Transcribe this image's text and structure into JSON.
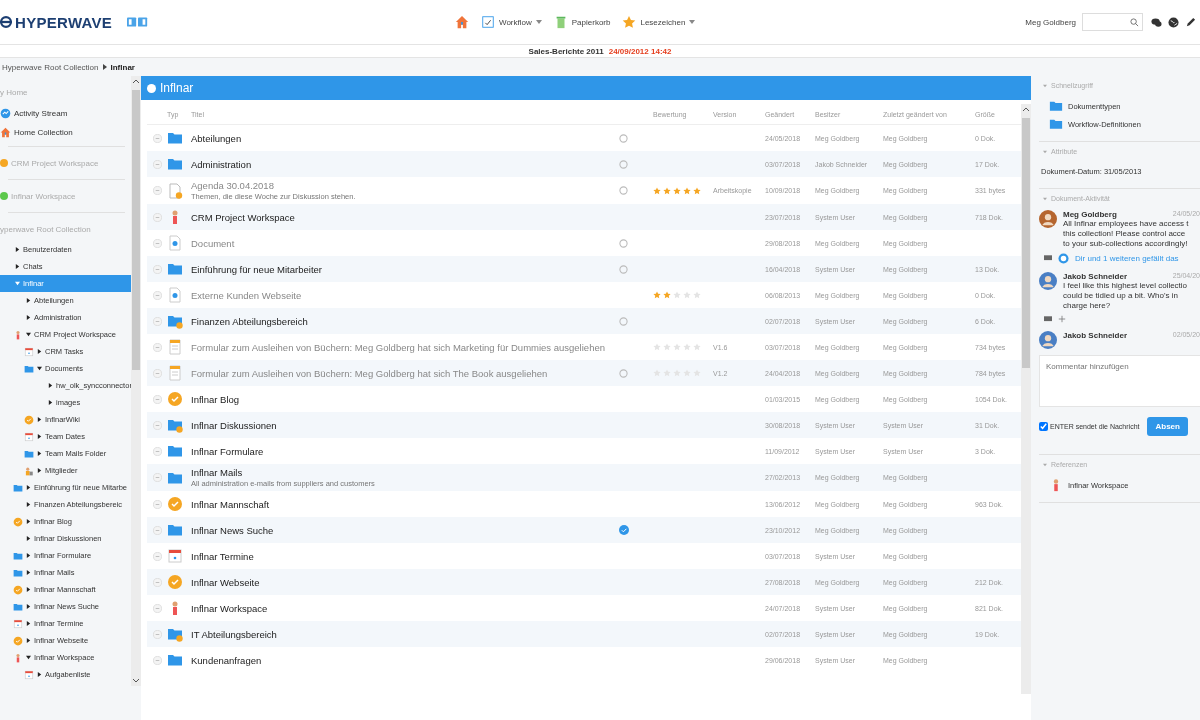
{
  "header": {
    "logo": "HYPERWAVE",
    "nav": [
      {
        "kind": "home"
      },
      {
        "kind": "workflow",
        "label": "Workflow",
        "dropdown": true
      },
      {
        "kind": "trash",
        "label": "Papierkorb",
        "dropdown": false
      },
      {
        "kind": "star",
        "label": "Lesezeichen",
        "dropdown": true
      }
    ],
    "user": "Meg Goldberg"
  },
  "context": {
    "title": "Sales-Berichte 2011",
    "timestamp": "24/09/2012 14:42"
  },
  "breadcrumb": [
    "Hyperwave Root Collection",
    "Inflnar"
  ],
  "sidebar": {
    "home_heading": "y Home",
    "home_items": [
      {
        "kind": "activity",
        "label": "Activity Stream"
      },
      {
        "kind": "home",
        "label": "Home Collection"
      }
    ],
    "workspaces": [
      {
        "label": "CRM Project Workspace",
        "color": "#f5a623"
      },
      {
        "label": "Inflnar Workspace",
        "color": "#5cc84c"
      }
    ],
    "root_heading": "yperwave Root Collection",
    "tree": [
      {
        "label": "Benutzerdaten",
        "expanded": false,
        "selected": false
      },
      {
        "label": "Chats",
        "expanded": false,
        "selected": false
      },
      {
        "label": "Inflnar",
        "expanded": true,
        "selected": true,
        "children": [
          {
            "label": "Abteilungen",
            "expanded": false,
            "selected": false
          },
          {
            "label": "Administration",
            "expanded": false,
            "selected": false
          },
          {
            "label": "CRM Project Workspace",
            "kind": "person",
            "expanded": true,
            "selected": false,
            "children": [
              {
                "label": "CRM Tasks",
                "kind": "calendar",
                "expanded": false,
                "selected": false
              },
              {
                "label": "Documents",
                "kind": "folder",
                "expanded": true,
                "selected": false,
                "children": [
                  {
                    "label": "hw_olk_syncconnector",
                    "expanded": false,
                    "selected": false
                  },
                  {
                    "label": "images",
                    "expanded": false,
                    "selected": false
                  }
                ]
              },
              {
                "label": "InflnarWiki",
                "kind": "blog",
                "expanded": false,
                "selected": false
              },
              {
                "label": "Team Dates",
                "kind": "calendar",
                "expanded": false,
                "selected": false
              },
              {
                "label": "Team Mails Folder",
                "kind": "folder",
                "expanded": false,
                "selected": false
              },
              {
                "label": "Mitglieder",
                "kind": "people",
                "expanded": false,
                "selected": false
              }
            ]
          },
          {
            "label": "Einführung für neue Mitarbe",
            "kind": "folder",
            "expanded": false,
            "selected": false
          },
          {
            "label": "Finanzen Abteilungsbereic",
            "expanded": false,
            "selected": false
          },
          {
            "label": "Inflnar Blog",
            "kind": "blog",
            "expanded": false,
            "selected": false
          },
          {
            "label": "Inflnar Diskussionen",
            "expanded": false,
            "selected": false
          },
          {
            "label": "Inflnar Formulare",
            "kind": "folder",
            "expanded": false,
            "selected": false
          },
          {
            "label": "Inflnar Mails",
            "kind": "folder",
            "expanded": false,
            "selected": false
          },
          {
            "label": "Inflnar Mannschaft",
            "kind": "blog",
            "expanded": false,
            "selected": false
          },
          {
            "label": "Inflnar News Suche",
            "kind": "folder",
            "expanded": false,
            "selected": false
          },
          {
            "label": "Inflnar Termine",
            "kind": "calendar",
            "expanded": false,
            "selected": false
          },
          {
            "label": "Inflnar Webseite",
            "kind": "blog",
            "expanded": false,
            "selected": false
          },
          {
            "label": "Inflnar Workspace",
            "kind": "person",
            "expanded": true,
            "selected": false,
            "children": [
              {
                "label": "Aufgabenliste",
                "kind": "calendar",
                "expanded": false,
                "selected": false
              }
            ]
          }
        ]
      }
    ]
  },
  "panel": {
    "title": "Inflnar"
  },
  "table": {
    "columns": [
      "Typ",
      "Titel",
      "",
      "Bewertung",
      "Version",
      "Geändert",
      "Besitzer",
      "Zuletzt geändert von",
      "Größe"
    ],
    "rows": [
      {
        "kind": "folder",
        "title": "Abteilungen",
        "muted": false,
        "marker": {
          "kind": "circle"
        },
        "date": "24/05/2018",
        "owner": "Meg Goldberg",
        "modifier": "Meg Goldberg",
        "size": "0 Dok."
      },
      {
        "kind": "folder",
        "title": "Administration",
        "muted": false,
        "marker": {
          "kind": "circle"
        },
        "date": "03/07/2018",
        "owner": "Jakob Schneider",
        "modifier": "Meg Goldberg",
        "size": "17 Dok."
      },
      {
        "kind": "doc-alert",
        "title": "Agenda 30.04.2018",
        "subtitle": "Themen, die diese Woche zur Diskussion stehen.",
        "muted": true,
        "marker": {
          "kind": "circle"
        },
        "stars": 5,
        "version": "Arbeitskopie",
        "date": "10/09/2018",
        "owner": "Meg Goldberg",
        "modifier": "Meg Goldberg",
        "size": "331 bytes"
      },
      {
        "kind": "person",
        "title": "CRM Project Workspace",
        "muted": false,
        "date": "23/07/2018",
        "owner": "System User",
        "modifier": "Meg Goldberg",
        "size": "718 Dok."
      },
      {
        "kind": "web",
        "title": "Document",
        "muted": true,
        "marker": {
          "kind": "circle"
        },
        "date": "29/08/2018",
        "owner": "Meg Goldberg",
        "modifier": "Meg Goldberg"
      },
      {
        "kind": "folder",
        "title": "Einführung für neue Mitarbeiter",
        "muted": false,
        "marker": {
          "kind": "circle"
        },
        "date": "16/04/2018",
        "owner": "System User",
        "modifier": "Meg Goldberg",
        "size": "13 Dok."
      },
      {
        "kind": "web",
        "title": "Externe Kunden Webseite",
        "muted": true,
        "stars": 2,
        "date": "06/08/2013",
        "owner": "Meg Goldberg",
        "modifier": "Meg Goldberg",
        "size": "0 Dok."
      },
      {
        "kind": "folder-alert",
        "title": "Finanzen Abteilungsbereich",
        "muted": false,
        "marker": {
          "kind": "circle"
        },
        "date": "02/07/2018",
        "owner": "System User",
        "modifier": "Meg Goldberg",
        "size": "6 Dok."
      },
      {
        "kind": "form",
        "title": "Formular zum Ausleihen von Büchern: Meg Goldberg hat sich Marketing für Dummies ausgeliehen",
        "muted": true,
        "stars": 0,
        "version": "V1.6",
        "date": "03/07/2018",
        "owner": "Meg Goldberg",
        "modifier": "Meg Goldberg",
        "size": "734 bytes"
      },
      {
        "kind": "form",
        "title": "Formular zum Ausleihen von Büchern: Meg Goldberg hat sich The Book ausgeliehen",
        "muted": true,
        "marker": {
          "kind": "circle"
        },
        "stars": 0,
        "version": "V1.2",
        "date": "24/04/2018",
        "owner": "Meg Goldberg",
        "modifier": "Meg Goldberg",
        "size": "784 bytes"
      },
      {
        "kind": "blog",
        "title": "Inflnar Blog",
        "muted": false,
        "date": "01/03/2015",
        "owner": "Meg Goldberg",
        "modifier": "Meg Goldberg",
        "size": "1054 Dok."
      },
      {
        "kind": "folder-alert",
        "title": "Inflnar Diskussionen",
        "muted": false,
        "date": "30/08/2018",
        "owner": "System User",
        "modifier": "System User",
        "size": "31 Dok."
      },
      {
        "kind": "folder",
        "title": "Inflnar Formulare",
        "muted": false,
        "date": "11/09/2012",
        "owner": "System User",
        "modifier": "System User",
        "size": "3 Dok."
      },
      {
        "kind": "folder",
        "title": "Inflnar Mails",
        "subtitle": "All administration e-mails from suppliers and customers",
        "muted": false,
        "date": "27/02/2013",
        "owner": "Meg Goldberg",
        "modifier": "Meg Goldberg"
      },
      {
        "kind": "blog",
        "title": "Inflnar Mannschaft",
        "muted": false,
        "date": "13/06/2012",
        "owner": "Meg Goldberg",
        "modifier": "Meg Goldberg",
        "size": "963 Dok."
      },
      {
        "kind": "folder",
        "title": "Inflnar News Suche",
        "muted": false,
        "marker": {
          "kind": "checked"
        },
        "date": "23/10/2012",
        "owner": "Meg Goldberg",
        "modifier": "Meg Goldberg"
      },
      {
        "kind": "calendar",
        "title": "Inflnar Termine",
        "muted": false,
        "date": "03/07/2018",
        "owner": "System User",
        "modifier": "Meg Goldberg"
      },
      {
        "kind": "blog",
        "title": "Inflnar Webseite",
        "muted": false,
        "date": "27/08/2018",
        "owner": "Meg Goldberg",
        "modifier": "Meg Goldberg",
        "size": "212 Dok."
      },
      {
        "kind": "person",
        "title": "Inflnar Workspace",
        "muted": false,
        "date": "24/07/2018",
        "owner": "System User",
        "modifier": "Meg Goldberg",
        "size": "821 Dok."
      },
      {
        "kind": "folder-alert",
        "title": "IT Abteilungsbereich",
        "muted": false,
        "date": "02/07/2018",
        "owner": "System User",
        "modifier": "Meg Goldberg",
        "size": "19 Dok."
      },
      {
        "kind": "folder",
        "title": "Kundenanfragen",
        "muted": false,
        "date": "29/06/2018",
        "owner": "System User",
        "modifier": "Meg Goldberg"
      }
    ]
  },
  "right": {
    "quick": {
      "heading": "Schnellzugriff",
      "links": [
        "Dokumenttypen",
        "Workflow-Definitionen"
      ]
    },
    "attributes": {
      "heading": "Attribute",
      "text": "Dokument-Datum: 31/05/2013"
    },
    "activity": {
      "heading": "Dokument-Aktivität",
      "comments": [
        {
          "author": "Meg Goldberg",
          "date": "24/05/20",
          "text": "All Inflnar employees have access t\nthis collection! Please control acce\nto your sub-collections accordingly!",
          "like": "Dir und 1 weiteren gefällt das",
          "color": "#b5652e"
        },
        {
          "author": "Jakob Schneider",
          "date": "25/04/20",
          "text": "I feel like this highest level collectio\ncould be tidied up a bit. Who's in\ncharge here?",
          "color": "#4a7fc4"
        },
        {
          "author": "Jakob Schneider",
          "date": "02/05/20",
          "color": "#4a7fc4"
        }
      ],
      "placeholder": "Kommentar hinzufügen",
      "enter_sends": true,
      "enter_label": "ENTER sendet die Nachricht",
      "send": "Absen"
    },
    "references": {
      "heading": "Referenzen",
      "items": [
        "Inflnar Workspace"
      ]
    }
  }
}
